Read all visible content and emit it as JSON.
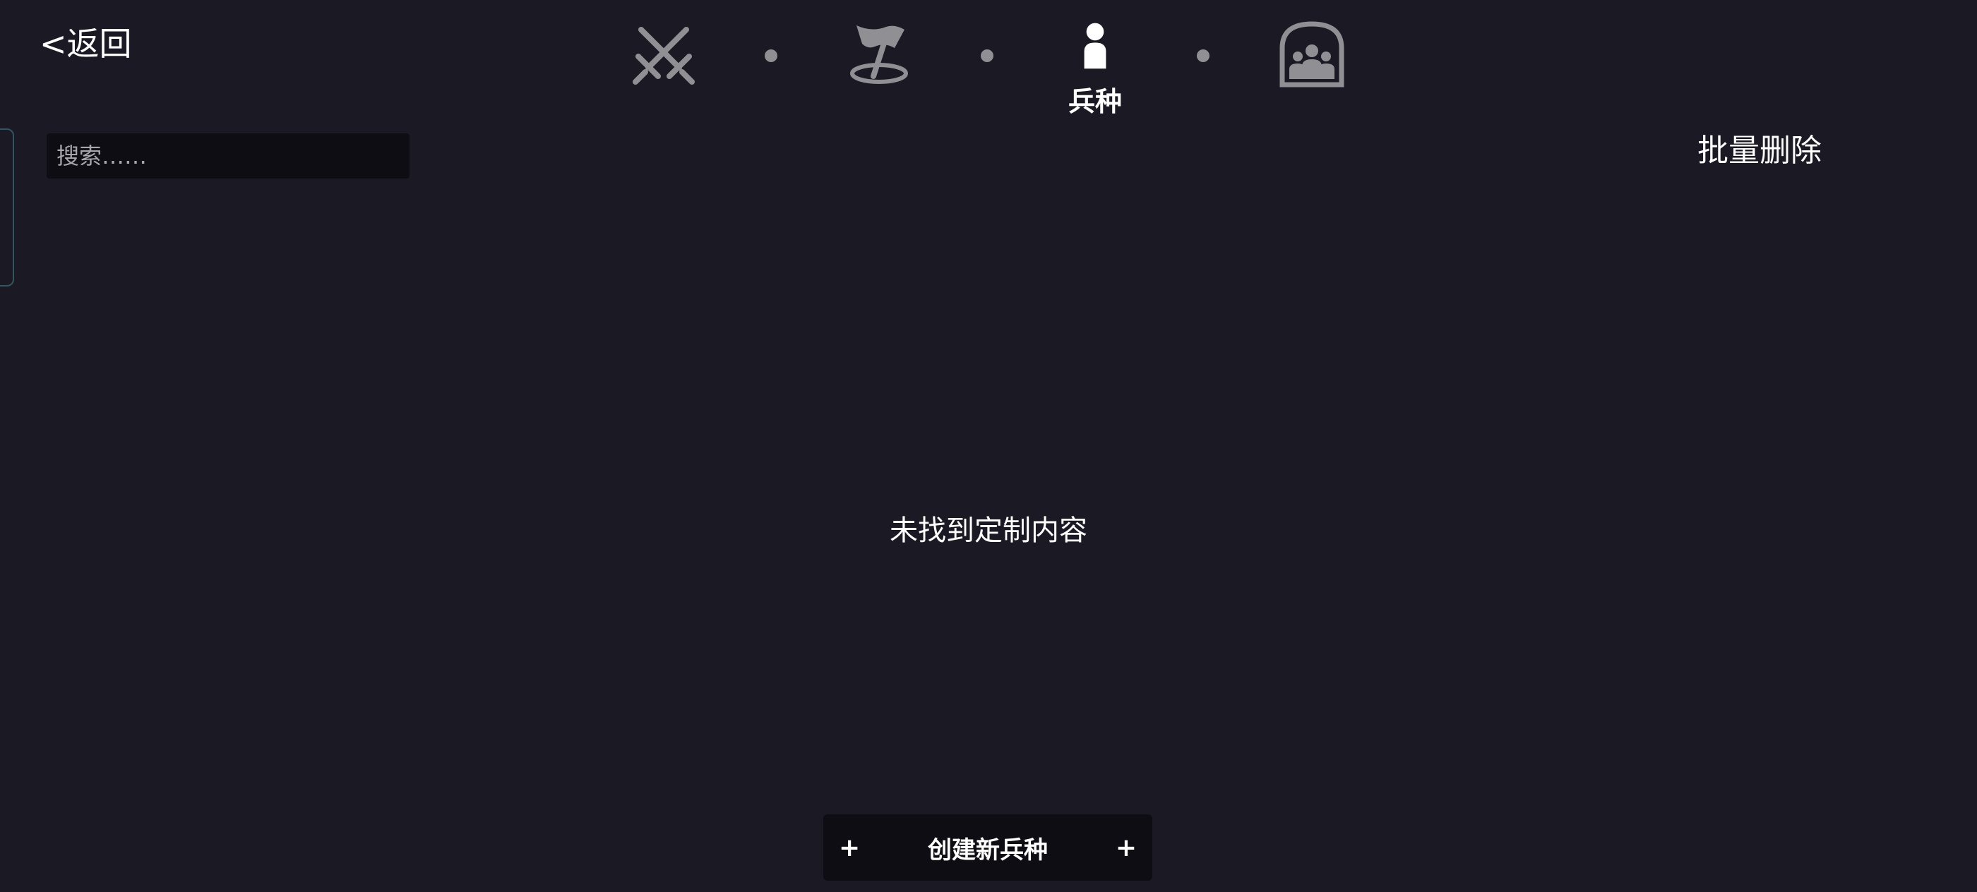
{
  "header": {
    "back_label": "<返回"
  },
  "search": {
    "placeholder": "搜索……",
    "value": ""
  },
  "steps": [
    {
      "icon": "crossed-swords-icon",
      "label": "",
      "active": false
    },
    {
      "icon": "flag-icon",
      "label": "",
      "active": false
    },
    {
      "icon": "soldier-icon",
      "label": "兵种",
      "active": true
    },
    {
      "icon": "group-portrait-icon",
      "label": "",
      "active": false
    }
  ],
  "toolbar": {
    "batch_delete_label": "批量删除"
  },
  "main": {
    "empty_message": "未找到定制内容"
  },
  "footer": {
    "create_plus_left": "+",
    "create_label": "创建新兵种",
    "create_plus_right": "+"
  },
  "colors": {
    "background": "#1b1a24",
    "panel": "#0d0d13",
    "icon_inactive": "#8f8f94",
    "icon_active": "#ffffff",
    "accent_border": "#2f5661"
  }
}
